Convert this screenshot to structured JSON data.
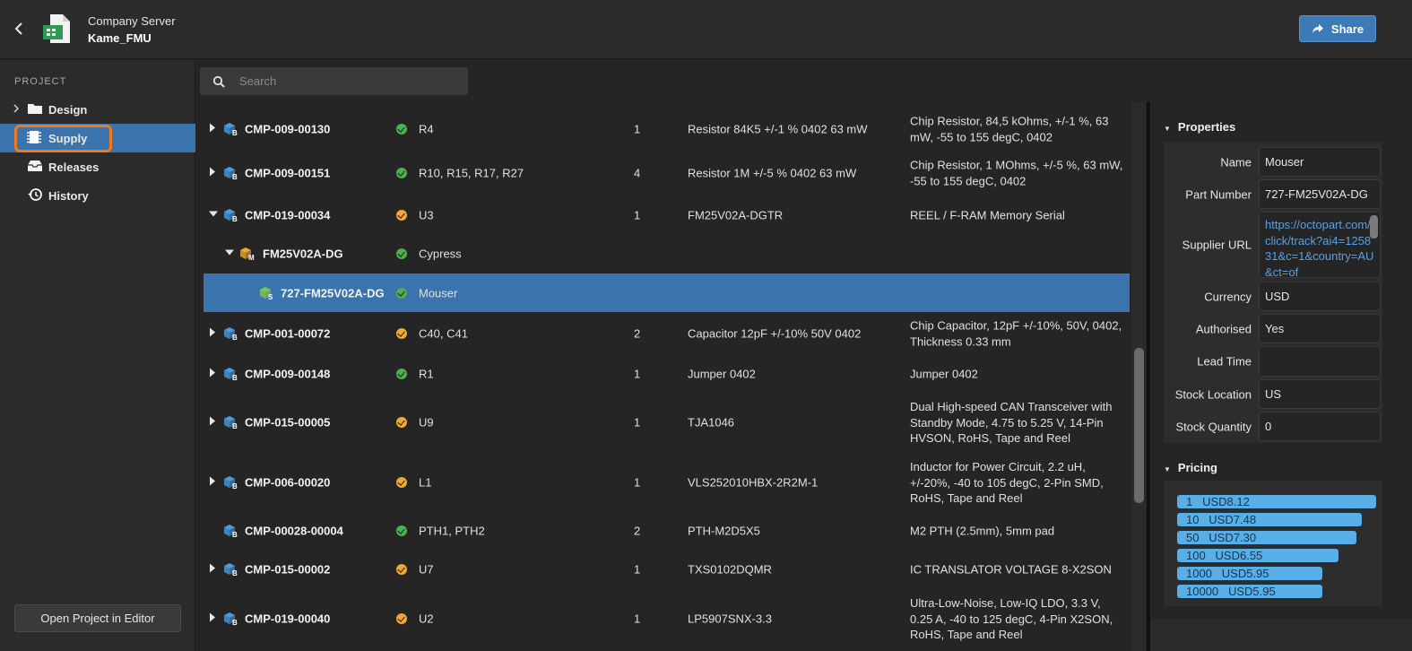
{
  "header": {
    "server": "Company Server",
    "project": "Kame_FMU",
    "share_label": "Share"
  },
  "sidebar": {
    "title": "PROJECT",
    "items": [
      {
        "label": "Design",
        "icon": "folder-icon"
      },
      {
        "label": "Supply",
        "icon": "chip-icon"
      },
      {
        "label": "Releases",
        "icon": "inbox-icon"
      },
      {
        "label": "History",
        "icon": "history-icon"
      }
    ],
    "open_button": "Open Project in Editor"
  },
  "search": {
    "placeholder": "Search"
  },
  "rows": [
    {
      "code": "CMP-009-00130",
      "status": "green",
      "designators": "R4",
      "qty": "1",
      "part": "Resistor 84K5 +/-1 % 0402 63 mW",
      "desc": "Chip Resistor, 84,5 kOhms, +/-1 %, 63 mW, -55 to 155 degC, 0402"
    },
    {
      "code": "CMP-009-00151",
      "status": "green",
      "designators": "R10, R15, R17, R27",
      "qty": "4",
      "part": "Resistor 1M +/-5 % 0402 63 mW",
      "desc": "Chip Resistor, 1 MOhms, +/-5 %, 63 mW, -55 to 155 degC, 0402"
    },
    {
      "code": "CMP-019-00034",
      "status": "orange",
      "designators": "U3",
      "qty": "1",
      "part": "FM25V02A-DGTR",
      "desc": "REEL / F-RAM Memory Serial"
    },
    {
      "code": "FM25V02A-DG",
      "status": "green",
      "designators": "Cypress",
      "qty": "",
      "part": "",
      "desc": ""
    },
    {
      "code": "727-FM25V02A-DG",
      "status": "green",
      "designators": "Mouser",
      "qty": "",
      "part": "",
      "desc": ""
    },
    {
      "code": "CMP-001-00072",
      "status": "orange",
      "designators": "C40, C41",
      "qty": "2",
      "part": "Capacitor 12pF +/-10% 50V 0402",
      "desc": "Chip Capacitor, 12pF +/-10%, 50V, 0402, Thickness 0.33 mm"
    },
    {
      "code": "CMP-009-00148",
      "status": "green",
      "designators": "R1",
      "qty": "1",
      "part": "Jumper 0402",
      "desc": "Jumper 0402"
    },
    {
      "code": "CMP-015-00005",
      "status": "orange",
      "designators": "U9",
      "qty": "1",
      "part": "TJA1046",
      "desc": "Dual High-speed CAN Transceiver with Standby Mode, 4.75 to 5.25 V, 14-Pin HVSON, RoHS, Tape and Reel"
    },
    {
      "code": "CMP-006-00020",
      "status": "orange",
      "designators": "L1",
      "qty": "1",
      "part": "VLS252010HBX-2R2M-1",
      "desc": "Inductor for Power Circuit, 2.2 uH, +/-20%, -40 to 105 degC, 2-Pin SMD, RoHS, Tape and Reel"
    },
    {
      "code": "CMP-00028-00004",
      "status": "green",
      "designators": "PTH1, PTH2",
      "qty": "2",
      "part": "PTH-M2D5X5",
      "desc": "M2 PTH (2.5mm), 5mm pad"
    },
    {
      "code": "CMP-015-00002",
      "status": "orange",
      "designators": "U7",
      "qty": "1",
      "part": "TXS0102DQMR",
      "desc": "IC TRANSLATOR VOLTAGE 8-X2SON"
    },
    {
      "code": "CMP-019-00040",
      "status": "orange",
      "designators": "U2",
      "qty": "1",
      "part": "LP5907SNX-3.3",
      "desc": "Ultra-Low-Noise, Low-IQ LDO, 3.3 V, 0.25 A, -40 to 125 degC, 4-Pin X2SON, RoHS, Tape and Reel"
    }
  ],
  "properties": {
    "title": "Properties",
    "fields": [
      {
        "label": "Name",
        "value": "Mouser"
      },
      {
        "label": "Part Number",
        "value": "727-FM25V02A-DG"
      },
      {
        "label": "Supplier URL",
        "value": "https://octopart.com/click/track?ai4=125831&c=1&country=AU&ct=of"
      },
      {
        "label": "Currency",
        "value": "USD"
      },
      {
        "label": "Authorised",
        "value": "Yes"
      },
      {
        "label": "Lead Time",
        "value": ""
      },
      {
        "label": "Stock Location",
        "value": "US"
      },
      {
        "label": "Stock Quantity",
        "value": "0"
      }
    ]
  },
  "pricing": {
    "title": "Pricing",
    "breaks": [
      {
        "label": "1   USD8.12",
        "fill": 1.0
      },
      {
        "label": "10   USD7.48",
        "fill": 0.93
      },
      {
        "label": "50   USD7.30",
        "fill": 0.9
      },
      {
        "label": "100   USD6.55",
        "fill": 0.81
      },
      {
        "label": "1000   USD5.95",
        "fill": 0.73
      },
      {
        "label": "10000   USD5.95",
        "fill": 0.73
      }
    ]
  },
  "colors": {
    "accent": "#3b74ad",
    "status_green": "#4caf50",
    "status_orange": "#f0a830",
    "highlight": "#f07a1c",
    "price_bar": "#58aee6"
  }
}
